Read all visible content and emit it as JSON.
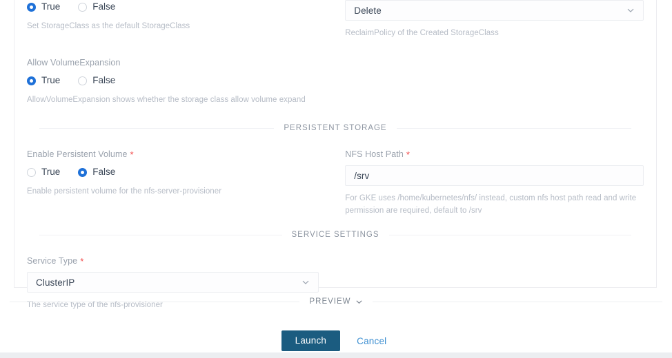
{
  "form": {
    "top_fields": {
      "default_storage_class": {
        "options": [
          "True",
          "False"
        ],
        "selected": "True",
        "help": "Set StorageClass as the default StorageClass"
      },
      "reclaim_policy": {
        "value": "Delete",
        "help": "ReclaimPolicy of the Created StorageClass",
        "chevron_icon": "chevron-down-icon"
      },
      "allow_volume_expansion": {
        "label": "Allow VolumeExpansion",
        "options": [
          "True",
          "False"
        ],
        "selected": "True",
        "help": "AllowVolumeExpansion shows whether the storage class allow volume expand"
      }
    },
    "sections": {
      "persistent_storage": {
        "title": "PERSISTENT STORAGE",
        "enable_persistent_volume": {
          "label": "Enable Persistent Volume",
          "required": "*",
          "options": [
            "True",
            "False"
          ],
          "selected": "False",
          "help": "Enable persistent volume for the nfs-server-provisioner"
        },
        "nfs_host_path": {
          "label": "NFS Host Path",
          "required": "*",
          "value": "/srv",
          "help": "For GKE uses /home/kubernetes/nfs/ instead, custom nfs host path read and write permission are required, default to /srv"
        }
      },
      "service_settings": {
        "title": "SERVICE SETTINGS",
        "service_type": {
          "label": "Service Type",
          "required": "*",
          "value": "ClusterIP",
          "help": "The service type of the nfs-provisioner",
          "chevron_icon": "chevron-down-icon"
        }
      }
    }
  },
  "preview": {
    "label": "PREVIEW",
    "chevron_icon": "chevron-down-icon"
  },
  "actions": {
    "launch_label": "Launch",
    "cancel_label": "Cancel"
  },
  "colors": {
    "primary_button": "#1b5c80",
    "link": "#3d8fd1",
    "radio_selected": "#1f71d8",
    "required_asterisk": "#f24b4b",
    "label_text": "#9aa2ad",
    "help_text": "#b6bcc6",
    "value_text": "#3c4858",
    "border": "#eceef1"
  }
}
